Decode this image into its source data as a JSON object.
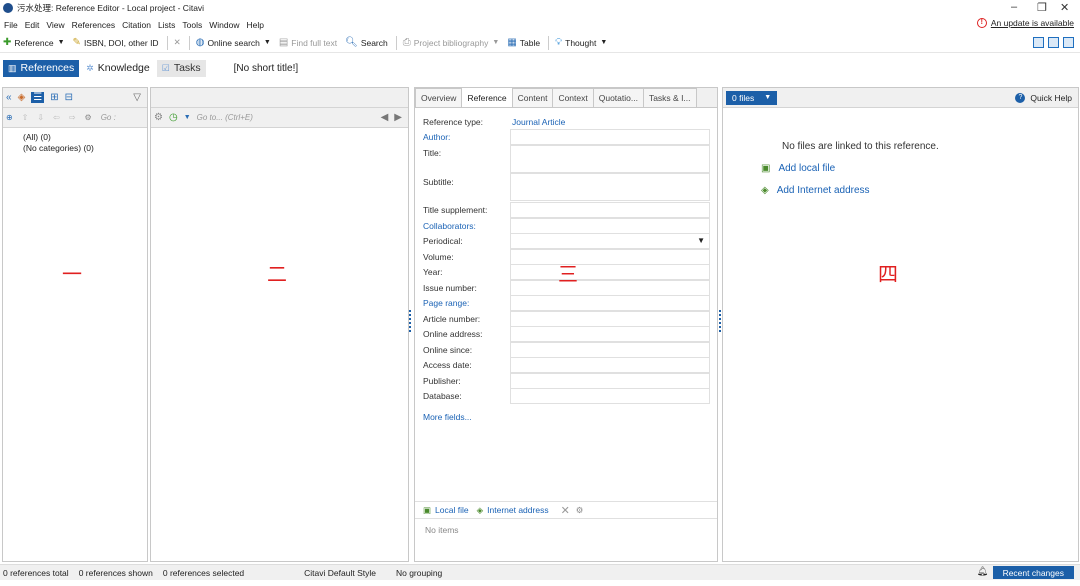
{
  "window": {
    "title": "污水处理: Reference Editor - Local project - Citavi"
  },
  "menu": [
    "File",
    "Edit",
    "View",
    "References",
    "Citation",
    "Lists",
    "Tools",
    "Window",
    "Help"
  ],
  "update_notice": "An update is available",
  "toolbar": {
    "reference": "Reference",
    "isbn": "ISBN, DOI, other ID",
    "online_search": "Online search",
    "find_full_text": "Find full text",
    "search": "Search",
    "project_bibliography": "Project bibliography",
    "table": "Table",
    "thought": "Thought"
  },
  "modes": {
    "references": "References",
    "knowledge": "Knowledge",
    "tasks": "Tasks"
  },
  "short_title": "[No short title!]",
  "categories": [
    "(All) (0)",
    "(No categories) (0)"
  ],
  "panel1": {
    "goto": "Go :"
  },
  "panel2": {
    "goto": "Go to... (Ctrl+E)"
  },
  "markers": {
    "p1": "一",
    "p2": "二",
    "p3": "三",
    "p4": "四"
  },
  "editor": {
    "tabs": [
      "Overview",
      "Reference",
      "Content",
      "Context",
      "Quotatio...",
      "Tasks & I..."
    ],
    "active_tab": "Reference",
    "reference_type_label": "Reference type:",
    "reference_type_value": "Journal Article",
    "fields": {
      "author": "Author:",
      "title": "Title:",
      "subtitle": "Subtitle:",
      "title_supplement": "Title supplement:",
      "collaborators": "Collaborators:",
      "periodical": "Periodical:",
      "volume": "Volume:",
      "year": "Year:",
      "issue_number": "Issue number:",
      "page_range": "Page range:",
      "article_number": "Article number:",
      "online_address": "Online address:",
      "online_since": "Online since:",
      "access_date": "Access date:",
      "publisher": "Publisher:",
      "database": "Database:"
    },
    "more_fields": "More fields...",
    "local_file": "Local file",
    "internet_address": "Internet address",
    "no_items": "No items"
  },
  "files": {
    "count_label": "0 files",
    "quick_help": "Quick Help",
    "no_files": "No files are linked to this reference.",
    "add_local_file": "Add local file",
    "add_internet_address": "Add Internet address"
  },
  "status": {
    "total": "0 references total",
    "shown": "0 references shown",
    "selected": "0 references selected",
    "style": "Citavi Default Style",
    "grouping": "No grouping",
    "recent_changes": "Recent changes"
  }
}
